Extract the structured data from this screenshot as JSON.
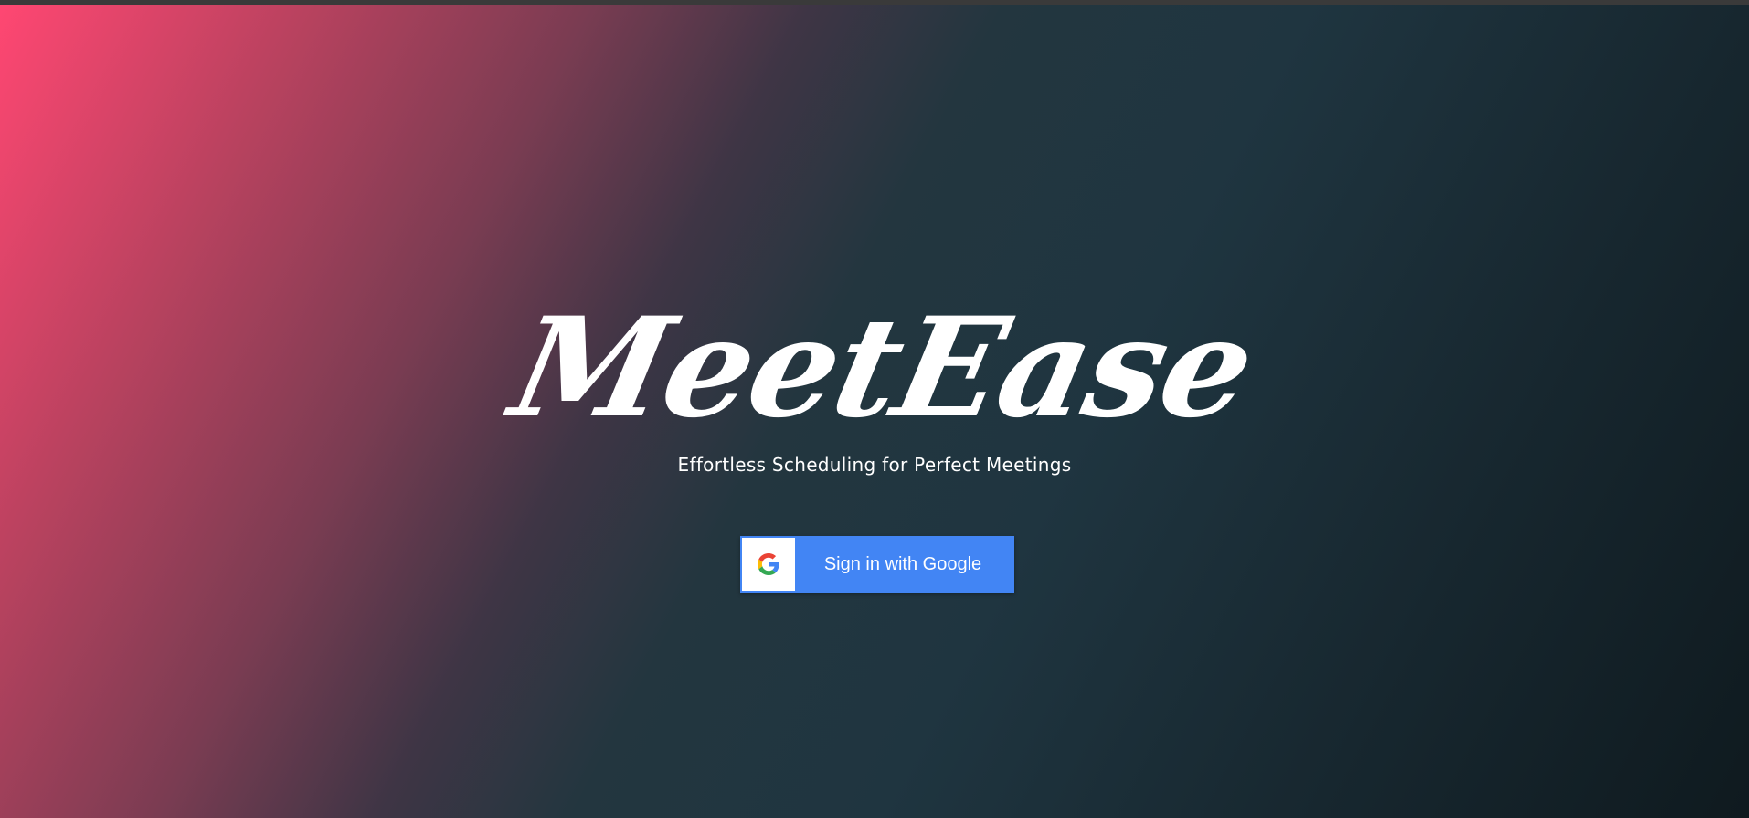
{
  "brand": {
    "logo_text": "MeetEase",
    "tagline": "Effortless Scheduling for Perfect Meetings"
  },
  "auth": {
    "google_button_label": "Sign in with Google",
    "icon": "google-g-icon"
  },
  "colors": {
    "gradient_start": "#ff4772",
    "gradient_end": "#0f1a1f",
    "google_button": "#4285f4",
    "text": "#ffffff"
  }
}
